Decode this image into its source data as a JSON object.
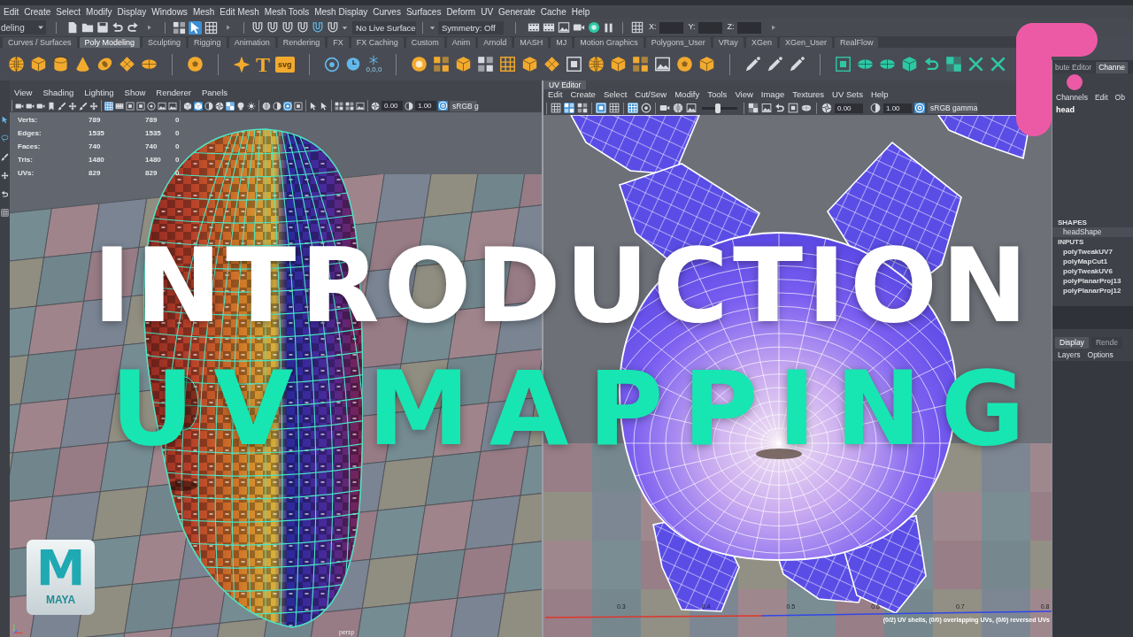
{
  "menu_bar": [
    "Edit",
    "Create",
    "Select",
    "Modify",
    "Display",
    "Windows",
    "Mesh",
    "Edit Mesh",
    "Mesh Tools",
    "Mesh Display",
    "Curves",
    "Surfaces",
    "Deform",
    "UV",
    "Generate",
    "Cache",
    "Help"
  ],
  "toolbar": {
    "mode": "deling",
    "select_modes": [
      {
        "selected": false
      },
      {
        "selected": true
      },
      {
        "selected": false
      }
    ],
    "live_surface": "No Live Surface",
    "symmetry": "Symmetry: Off",
    "coords": [
      "X:",
      "Y:",
      "Z:"
    ]
  },
  "shelf_tabs": [
    {
      "label": "Curves / Surfaces",
      "selected": false
    },
    {
      "label": "Poly Modeling",
      "selected": true
    },
    {
      "label": "Sculpting",
      "selected": false
    },
    {
      "label": "Rigging",
      "selected": false
    },
    {
      "label": "Animation",
      "selected": false
    },
    {
      "label": "Rendering",
      "selected": false
    },
    {
      "label": "FX",
      "selected": false
    },
    {
      "label": "FX Caching",
      "selected": false
    },
    {
      "label": "Custom",
      "selected": false
    },
    {
      "label": "Anim",
      "selected": false
    },
    {
      "label": "Arnold",
      "selected": false
    },
    {
      "label": "MASH",
      "selected": false
    },
    {
      "label": "MJ",
      "selected": false
    },
    {
      "label": "Motion Graphics",
      "selected": false
    },
    {
      "label": "Polygons_User",
      "selected": false
    },
    {
      "label": "VRay",
      "selected": false
    },
    {
      "label": "XGen",
      "selected": false
    },
    {
      "label": "XGen_User",
      "selected": false
    },
    {
      "label": "RealFlow",
      "selected": false
    }
  ],
  "shelf": {
    "type_tool": "T",
    "svg_tool": "svg",
    "origin_tool": "0,0,0"
  },
  "viewport": {
    "menu": [
      "View",
      "Shading",
      "Lighting",
      "Show",
      "Renderer",
      "Panels"
    ],
    "toolbar": [
      [
        {
          "on": false
        },
        {
          "on": false
        },
        {
          "on": false
        },
        {
          "on": false
        },
        {
          "on": false
        },
        {
          "on": false
        },
        {
          "on": false
        },
        {
          "on": false
        }
      ],
      [
        {
          "on": true
        },
        {
          "on": false
        },
        {
          "on": false
        },
        {
          "on": false
        },
        {
          "on": false
        },
        {
          "on": false
        },
        {
          "on": false
        }
      ],
      [
        {
          "on": false
        },
        {
          "on": true
        },
        {
          "on": false
        },
        {
          "on": false
        },
        {
          "on": true
        },
        {
          "on": false
        },
        {
          "on": false
        }
      ],
      [
        {
          "on": false
        },
        {
          "on": false
        },
        {
          "on": true
        },
        {
          "on": false
        }
      ],
      [
        {
          "on": false
        },
        {
          "on": false
        }
      ],
      [
        {
          "on": false
        },
        {
          "on": false
        },
        {
          "on": false
        }
      ]
    ],
    "exposure": "0.00",
    "gamma": "1.00",
    "color_management": {
      "on": true,
      "label": "sRGB g"
    },
    "stats": [
      {
        "label": "Verts:",
        "values": [
          "789",
          "789",
          "0"
        ]
      },
      {
        "label": "Edges:",
        "values": [
          "1535",
          "1535",
          "0"
        ]
      },
      {
        "label": "Faces:",
        "values": [
          "740",
          "740",
          "0"
        ]
      },
      {
        "label": "Tris:",
        "values": [
          "1480",
          "1480",
          "0"
        ]
      },
      {
        "label": "UVs:",
        "values": [
          "829",
          "829",
          "0"
        ]
      }
    ],
    "camera": "persp"
  },
  "uv_editor": {
    "tab": "UV Editor",
    "menu": [
      "Edit",
      "Create",
      "Select",
      "Cut/Sew",
      "Modify",
      "Tools",
      "View",
      "Image",
      "Textures",
      "UV Sets",
      "Help"
    ],
    "toolbar": [
      [
        {
          "on": false
        },
        {
          "on": true
        },
        {
          "on": false
        }
      ],
      [
        {
          "on": true
        },
        {
          "on": false
        }
      ],
      [
        {
          "on": true
        },
        {
          "on": false
        }
      ],
      [
        {
          "on": false
        },
        {
          "on": false
        },
        {
          "on": false
        }
      ],
      [
        {
          "on": false
        },
        {
          "on": false
        },
        {
          "on": false
        },
        {
          "on": false
        },
        {
          "on": false
        }
      ]
    ],
    "zoom_slider": {
      "level": 0.45
    },
    "exposure": "0.00",
    "gamma": "1.00",
    "color_management": {
      "on": true,
      "label": "sRGB gamma"
    },
    "axis_labels": [
      "0.3",
      "0.4",
      "0.5",
      "0.6",
      "0.7",
      "0.8"
    ],
    "status": "(0/2) UV shells, (0/0) overlapping UVs, (0/0) reversed UVs"
  },
  "channel_box": {
    "tabs": [
      {
        "label": "bute Editor",
        "selected": false
      },
      {
        "label": "Channe",
        "selected": true
      }
    ],
    "menu": [
      "Channels",
      "Edit",
      "Ob"
    ],
    "object": "head",
    "shapes_heading": "SHAPES",
    "shapes": [
      "headShape"
    ],
    "inputs_heading": "INPUTS",
    "inputs": [
      "polyTweakUV7",
      "polyMapCut1",
      "polyTweakUV6",
      "polyPlanarProj13",
      "polyPlanarProj12"
    ],
    "layer_tabs": [
      {
        "label": "Display",
        "selected": true
      },
      {
        "label": "Rende",
        "selected": false
      }
    ],
    "layer_menu": [
      "Layers",
      "Options"
    ]
  },
  "title": {
    "line_1": "INTRODUCTION",
    "line_2": "UV MAPPING"
  },
  "badge": {
    "letter": "M",
    "name": "MAYA"
  }
}
